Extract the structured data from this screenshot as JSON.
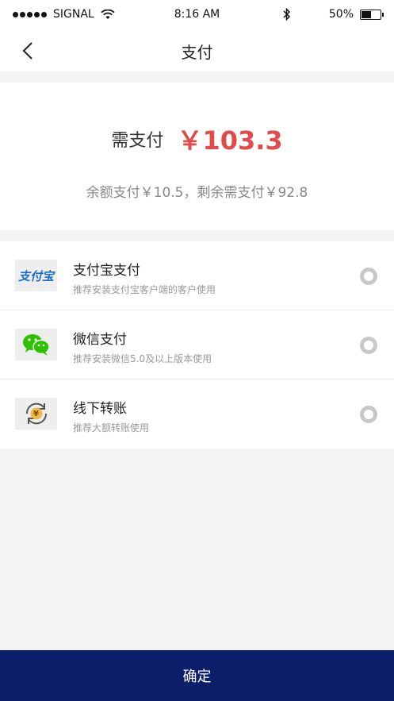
{
  "status_bar": {
    "carrier": "SIGNAL",
    "time": "8:16 AM",
    "battery": "50%",
    "battery_level": 0.5
  },
  "nav": {
    "title": "支付"
  },
  "amount": {
    "label": "需支付",
    "value": "￥103.3",
    "split": "余额支付￥10.5，剩余需支付￥92.8"
  },
  "payment_methods": [
    {
      "name": "支付宝支付",
      "desc": "推荐安装支付宝客户端的客户使用",
      "logo_text": "支付宝",
      "icon": "alipay-icon"
    },
    {
      "name": "微信支付",
      "desc": "推荐安装微信5.0及以上版本使用",
      "icon": "wechat-icon"
    },
    {
      "name": "线下转账",
      "desc": "推荐大额转账使用",
      "logo_text": "¥",
      "icon": "transfer-icon"
    }
  ],
  "confirm_label": "确定",
  "colors": {
    "amount_red": "#e34a4a",
    "confirm_bg": "#0b1f6b",
    "alipay_blue": "#1a6fc9",
    "wechat_green": "#2dc100"
  }
}
